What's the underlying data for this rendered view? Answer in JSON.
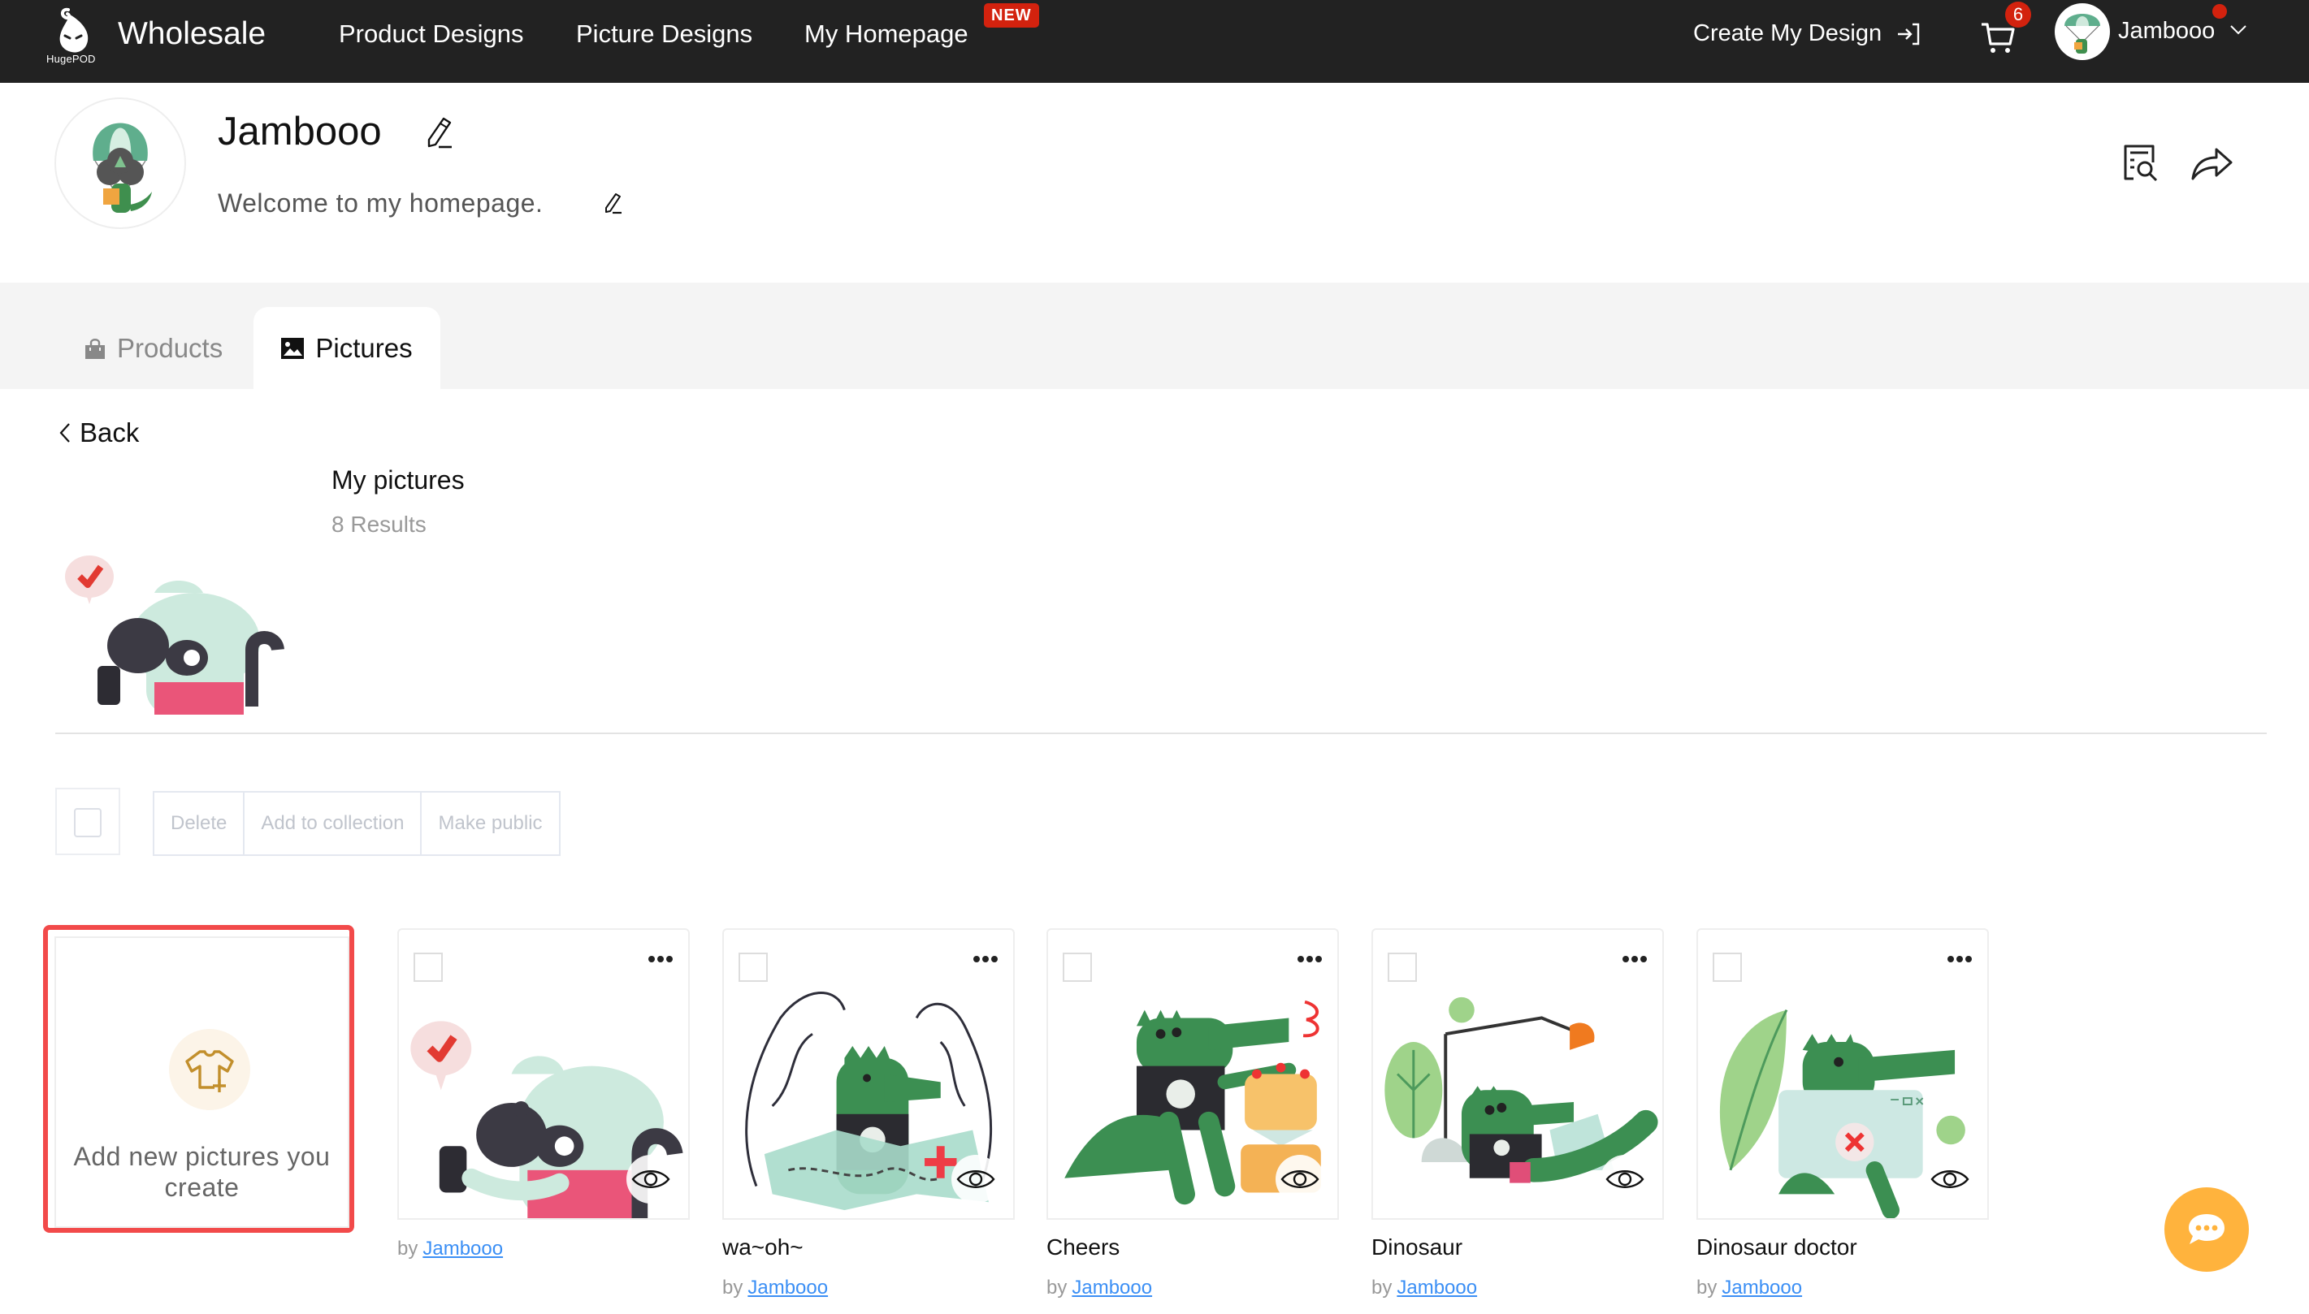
{
  "header": {
    "logo_text": "HugePOD",
    "brand": "Wholesale",
    "nav": [
      {
        "label": "Product Designs"
      },
      {
        "label": "Picture Designs"
      },
      {
        "label": "My Homepage",
        "badge": "NEW"
      }
    ],
    "create_design": "Create My Design",
    "cart_count": "6",
    "user_name": "Jambooo"
  },
  "profile": {
    "name": "Jambooo",
    "bio": "Welcome to my homepage."
  },
  "tabs": [
    {
      "label": "Products",
      "icon": "shopping-bag-icon",
      "active": false
    },
    {
      "label": "Pictures",
      "icon": "image-icon",
      "active": true
    }
  ],
  "collection": {
    "back_label": "Back",
    "title": "My pictures",
    "count": "8 Results"
  },
  "toolbar": {
    "actions": [
      "Delete",
      "Add to collection",
      "Make public"
    ]
  },
  "add_card": {
    "label": "Add new pictures you create"
  },
  "pictures": [
    {
      "title": "",
      "by_prefix": "by",
      "author": "Jambooo",
      "art": "lemur-phone"
    },
    {
      "title": "wa~oh~",
      "by_prefix": "by",
      "author": "Jambooo",
      "art": "croc-map"
    },
    {
      "title": "Cheers",
      "by_prefix": "by",
      "author": "Jambooo",
      "art": "croc-cake"
    },
    {
      "title": "Dinosaur",
      "by_prefix": "by",
      "author": "Jambooo",
      "art": "croc-laptop"
    },
    {
      "title": "Dinosaur doctor",
      "by_prefix": "by",
      "author": "Jambooo",
      "art": "croc-window"
    }
  ],
  "colors": {
    "header_bg": "#222222",
    "badge_red": "#d3220e",
    "highlight_border": "#f24a4a",
    "link_blue": "#3b8ff5",
    "chat_orange": "#ffb33d",
    "add_icon_gold": "#c28f2c"
  }
}
